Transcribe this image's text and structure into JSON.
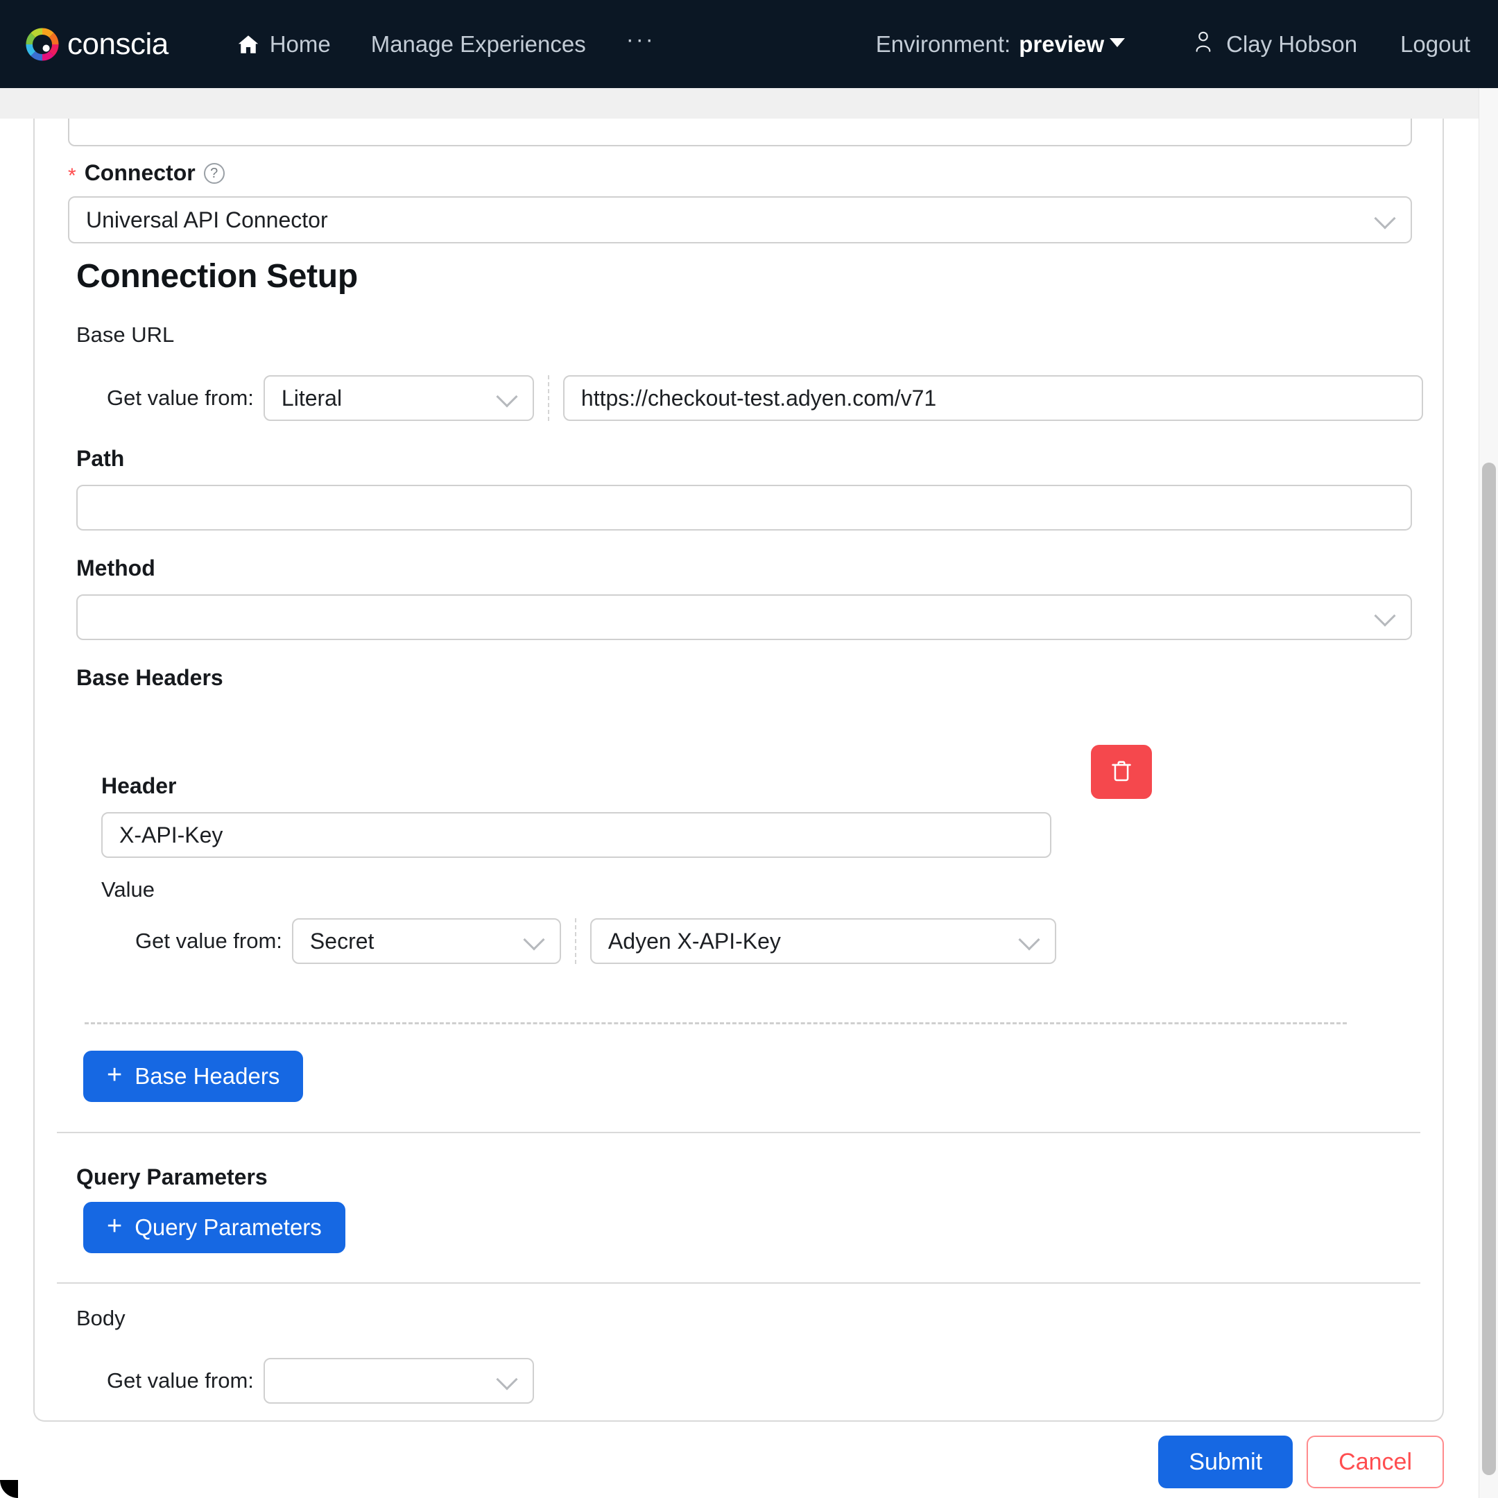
{
  "nav": {
    "brand": "conscia",
    "links": [
      {
        "label": "Home",
        "icon": "home-icon"
      },
      {
        "label": "Manage Experiences",
        "icon": null
      }
    ],
    "overflow": "···",
    "environment_label": "Environment:",
    "environment_value": "preview",
    "user_name": "Clay Hobson",
    "logout": "Logout"
  },
  "form": {
    "connector": {
      "label": "Connector",
      "required_marker": "*",
      "help_icon": "?",
      "value": "Universal API Connector"
    },
    "connection_setup_title": "Connection Setup",
    "base_url": {
      "label": "Base URL",
      "get_value_from_label": "Get value from:",
      "source": "Literal",
      "value": "https://checkout-test.adyen.com/v71"
    },
    "path": {
      "label": "Path",
      "value": ""
    },
    "method": {
      "label": "Method",
      "value": ""
    },
    "base_headers": {
      "label": "Base Headers",
      "delete_icon": "trash-icon",
      "rows": [
        {
          "header_label": "Header",
          "header_value": "X-API-Key",
          "value_label": "Value",
          "get_value_from_label": "Get value from:",
          "source": "Secret",
          "secret": "Adyen X-API-Key"
        }
      ],
      "add_button": "Base Headers",
      "add_icon": "plus-icon"
    },
    "query_parameters": {
      "label": "Query Parameters",
      "add_button": "Query Parameters",
      "add_icon": "plus-icon"
    },
    "body": {
      "label": "Body",
      "get_value_from_label": "Get value from:",
      "source": ""
    }
  },
  "actions": {
    "submit": "Submit",
    "cancel": "Cancel"
  },
  "colors": {
    "nav_bg": "#0b1724",
    "accent_blue": "#1668e3",
    "danger_red": "#f5484d",
    "cancel_red": "#ff4d4f",
    "required_star": "#ff4d4f"
  }
}
